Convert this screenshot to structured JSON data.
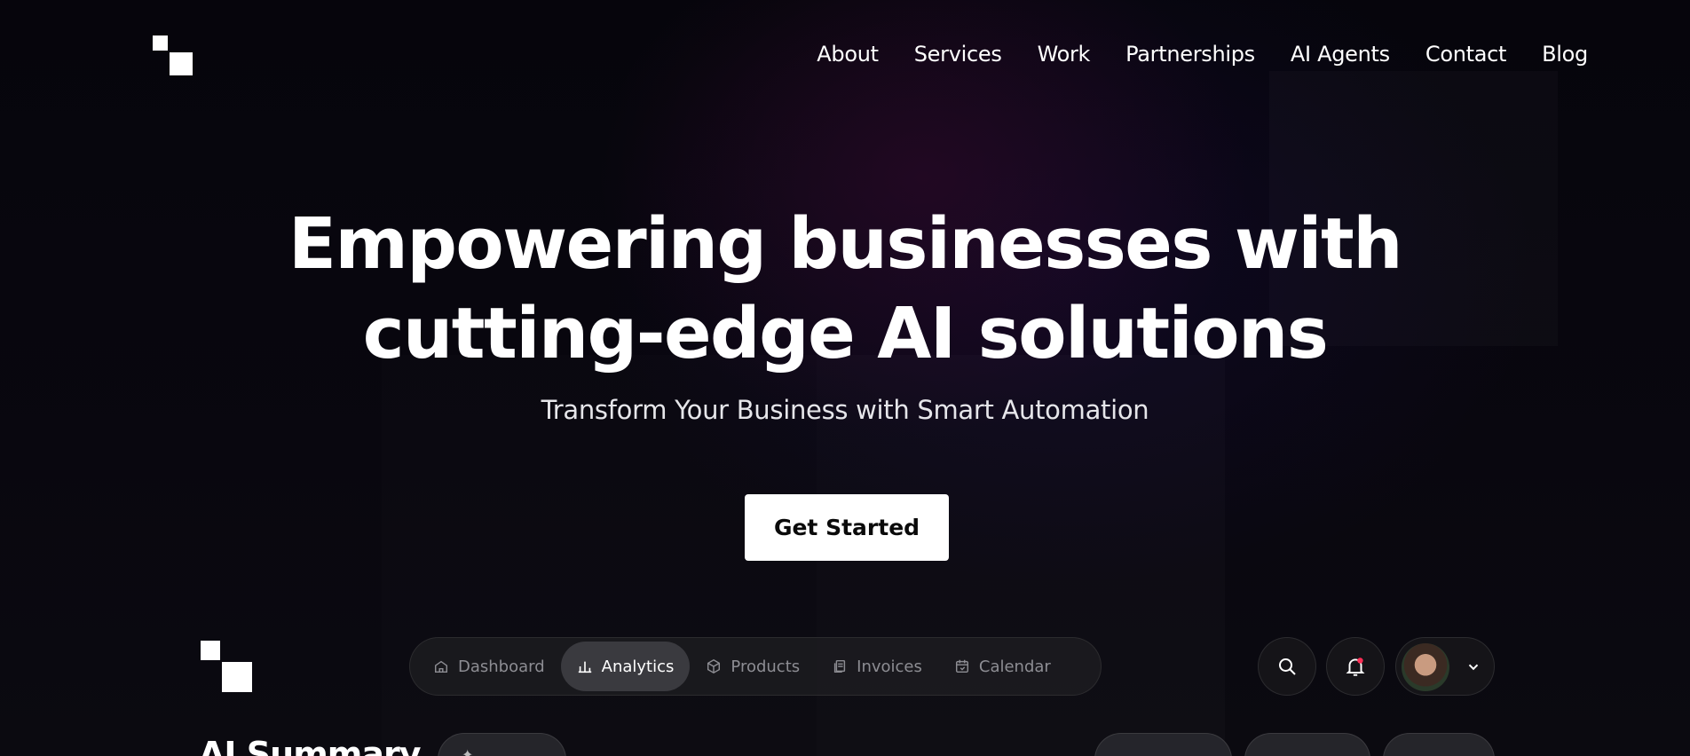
{
  "nav": {
    "items": [
      "About",
      "Services",
      "Work",
      "Partnerships",
      "AI Agents",
      "Contact",
      "Blog"
    ]
  },
  "hero": {
    "title_line1": "Empowering businesses with",
    "title_line2": "cutting-edge AI solutions",
    "subtitle": "Transform Your Business with Smart Automation",
    "cta_label": "Get Started"
  },
  "app": {
    "tabs": [
      {
        "label": "Dashboard",
        "icon": "home-icon",
        "active": false
      },
      {
        "label": "Analytics",
        "icon": "bar-chart-icon",
        "active": true
      },
      {
        "label": "Products",
        "icon": "box-icon",
        "active": false
      },
      {
        "label": "Invoices",
        "icon": "document-icon",
        "active": false
      },
      {
        "label": "Calendar",
        "icon": "calendar-icon",
        "active": false
      }
    ],
    "summary_title": "AI Summary",
    "colors": {
      "notification_dot": "#ff2d55",
      "active_tab": "#3a3a3f"
    }
  }
}
